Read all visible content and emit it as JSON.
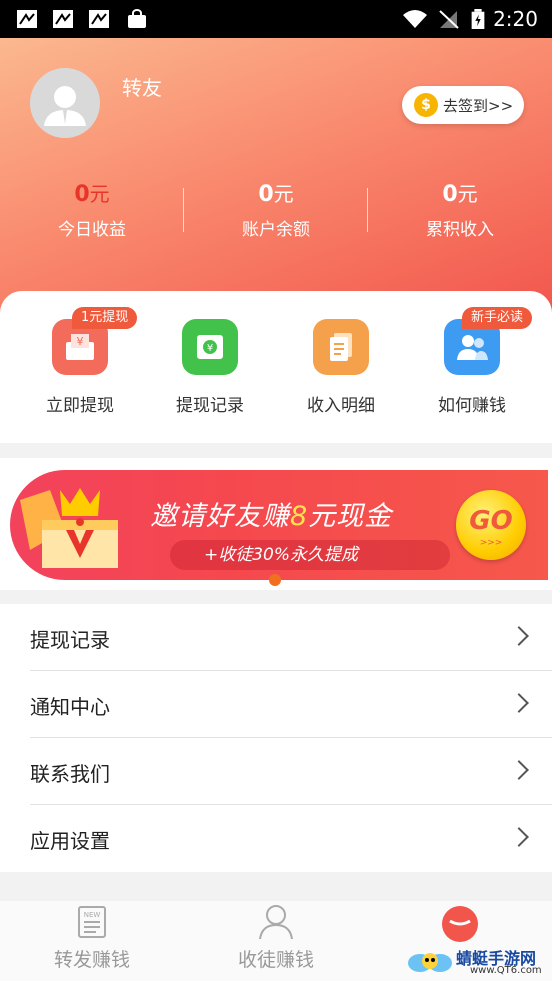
{
  "status_bar": {
    "time": "2:20"
  },
  "profile": {
    "username": "转友",
    "signin_label": "去签到>>",
    "coin_symbol": "$"
  },
  "stats": [
    {
      "value": "0",
      "unit": "元",
      "label": "今日收益",
      "color": "#e8352a"
    },
    {
      "value": "0",
      "unit": "元",
      "label": "账户余额",
      "color": "#ffffff"
    },
    {
      "value": "0",
      "unit": "元",
      "label": "累积收入",
      "color": "#ffffff"
    }
  ],
  "actions": [
    {
      "label": "立即提现",
      "tag": "1元提现",
      "icon": "wallet-yen-icon",
      "color": "#f26b5b"
    },
    {
      "label": "提现记录",
      "tag": "",
      "icon": "money-envelope-icon",
      "color": "#43c24b"
    },
    {
      "label": "收入明细",
      "tag": "",
      "icon": "document-list-icon",
      "color": "#f5a04a"
    },
    {
      "label": "如何赚钱",
      "tag": "新手必读",
      "icon": "users-icon",
      "color": "#3d9bf2"
    }
  ],
  "banner": {
    "title_pre": "邀请好友赚",
    "title_num": "8",
    "title_post": "元现金",
    "subtitle": "+收徒30%永久提成",
    "go_label": "GO",
    "go_arrows": ">>>"
  },
  "menu": [
    {
      "label": "提现记录"
    },
    {
      "label": "通知中心"
    },
    {
      "label": "联系我们"
    },
    {
      "label": "应用设置"
    }
  ],
  "tabs": [
    {
      "label": "转发赚钱",
      "icon": "news-icon"
    },
    {
      "label": "收徒赚钱",
      "icon": "person-icon"
    },
    {
      "label": "",
      "icon": "profile-active-icon"
    }
  ],
  "watermark": {
    "text": "蜻蜓手游网",
    "url": "www.QT6.com"
  },
  "colors": {
    "accent": "#f2554c",
    "header_light": "#fbb88f"
  }
}
